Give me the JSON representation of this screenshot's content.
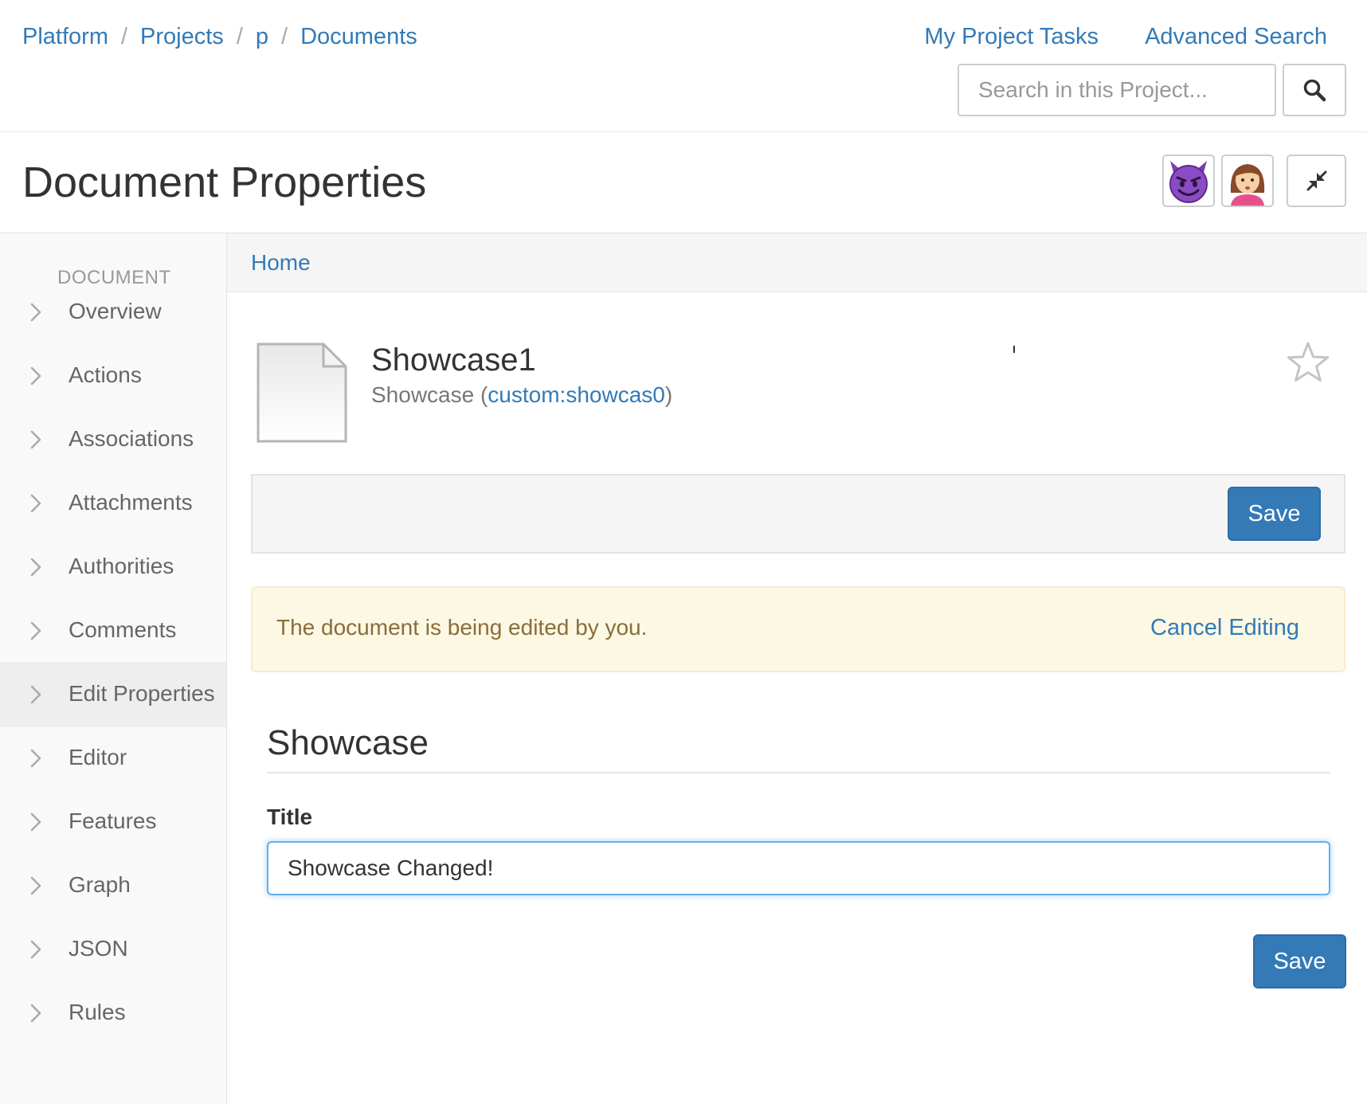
{
  "breadcrumb": {
    "items": [
      "Platform",
      "Projects",
      "p",
      "Documents"
    ],
    "separator": "/"
  },
  "top_links": {
    "tasks": "My Project Tasks",
    "advanced_search": "Advanced Search"
  },
  "search": {
    "placeholder": "Search in this Project...",
    "value": "",
    "icon": "search-icon"
  },
  "page": {
    "title": "Document Properties"
  },
  "avatars": [
    {
      "name": "smiling-devil-avatar",
      "emoji": "😈"
    },
    {
      "name": "woman-avatar",
      "emoji": "👩"
    }
  ],
  "header_icons": {
    "collapse": "compress-icon"
  },
  "sidebar": {
    "heading": "DOCUMENT",
    "active_index": 6,
    "items": [
      {
        "label": "Overview"
      },
      {
        "label": "Actions"
      },
      {
        "label": "Associations"
      },
      {
        "label": "Attachments"
      },
      {
        "label": "Authorities"
      },
      {
        "label": "Comments"
      },
      {
        "label": "Edit Properties"
      },
      {
        "label": "Editor"
      },
      {
        "label": "Features"
      },
      {
        "label": "Graph"
      },
      {
        "label": "JSON"
      },
      {
        "label": "Rules"
      }
    ]
  },
  "content_breadcrumb": {
    "home": "Home"
  },
  "document": {
    "title": "Showcase1",
    "type_label": "Showcase",
    "type_open": " (",
    "type_qname": "custom:showcas0",
    "type_close": ")",
    "favorite_icon": "star-outline-icon",
    "file_icon": "document-file-icon"
  },
  "actions": {
    "save_label": "Save"
  },
  "alert": {
    "message": "The document is being edited by you.",
    "cancel_label": "Cancel Editing"
  },
  "form": {
    "section_title": "Showcase",
    "fields": [
      {
        "label": "Title",
        "value": "Showcase Changed!"
      }
    ],
    "save_label": "Save"
  },
  "colors": {
    "link": "#337ab7",
    "primary_button": "#337ab7",
    "alert_background": "#fcf8e3",
    "alert_text": "#8a6d3b",
    "sidebar_background": "#f9f9f9",
    "sidebar_active": "#eeeeee",
    "input_focus_border": "#66afe9"
  }
}
